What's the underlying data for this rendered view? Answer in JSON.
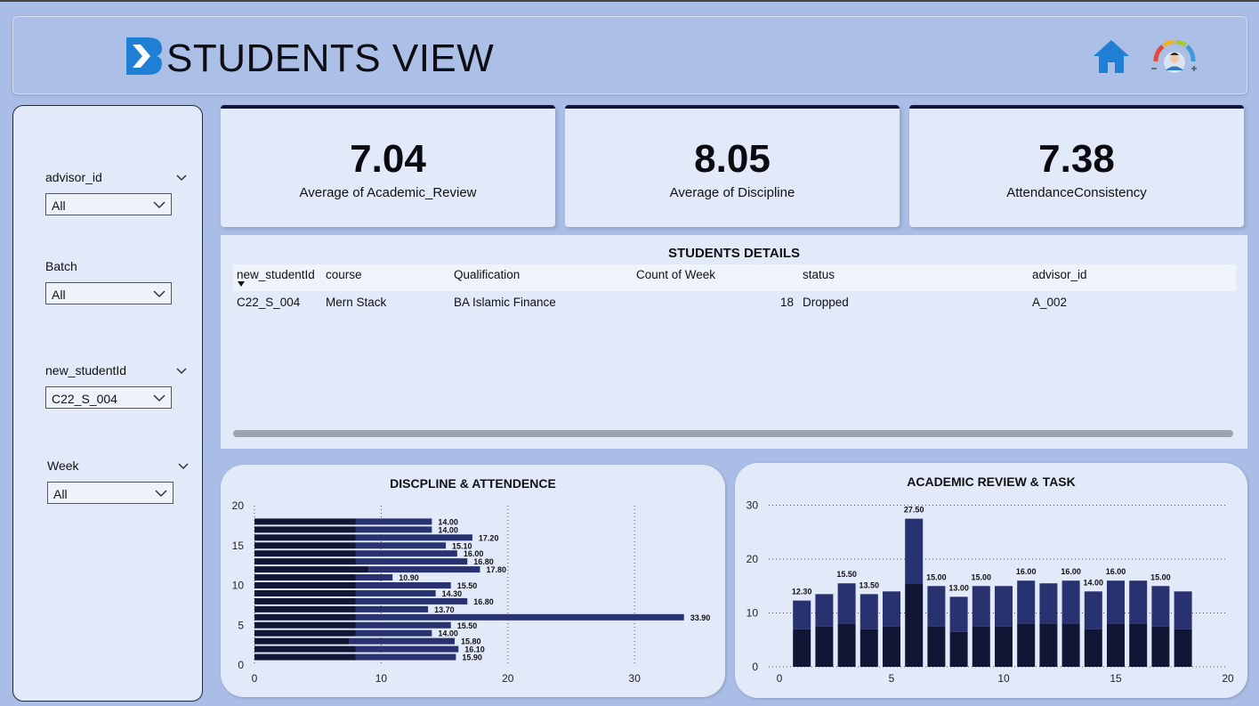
{
  "header": {
    "title": "STUDENTS VIEW"
  },
  "filters": [
    {
      "label": "advisor_id",
      "value": "All"
    },
    {
      "label": "Batch",
      "value": "All"
    },
    {
      "label": "new_studentId",
      "value": "C22_S_004"
    },
    {
      "label": "Week",
      "value": "All"
    }
  ],
  "cards": [
    {
      "value": "7.04",
      "label": "Average of Academic_Review"
    },
    {
      "value": "8.05",
      "label": "Average of Discipline"
    },
    {
      "value": "7.38",
      "label": "AttendanceConsistency"
    }
  ],
  "table": {
    "title": "STUDENTS DETAILS",
    "columns": [
      "new_studentId",
      "course",
      "Qualification",
      "Count of Week",
      "status",
      "advisor_id"
    ],
    "rows": [
      [
        "C22_S_004",
        "Mern Stack",
        "BA Islamic Finance",
        "18",
        "Dropped",
        "A_002"
      ]
    ]
  },
  "colors": {
    "dark": "#111634",
    "light": "#283270",
    "panel": "#e2e9f9"
  },
  "chart_data": [
    {
      "type": "bar",
      "orientation": "horizontal",
      "stacked": true,
      "title": "DISCPLINE & ATTENDENCE",
      "y": [
        18,
        17,
        16,
        15,
        14,
        13,
        12,
        11,
        10,
        9,
        8,
        7,
        6,
        5,
        4,
        3,
        2,
        1
      ],
      "series": [
        {
          "values": [
            8,
            8,
            8,
            8,
            8,
            8,
            9,
            8,
            8,
            8,
            8,
            8,
            8,
            8,
            8,
            7.5,
            8,
            8
          ]
        },
        {
          "values": [
            6,
            6,
            9.2,
            7.1,
            8,
            8.8,
            8.8,
            2.9,
            7.5,
            6.3,
            8.8,
            5.7,
            25.9,
            7.5,
            6,
            8.3,
            8.1,
            7.9
          ]
        }
      ],
      "totals": [
        "14.00",
        "14.00",
        "17.20",
        "15.10",
        "16.00",
        "16.80",
        "17.80",
        "10.90",
        "15.50",
        "14.30",
        "16.80",
        "13.70",
        "33.90",
        "15.50",
        "14.00",
        "15.80",
        "16.10",
        "15.90"
      ],
      "xlim": [
        0,
        35
      ],
      "ylim": [
        0,
        20
      ],
      "xticks": [
        "0",
        "10",
        "20",
        "30"
      ],
      "yticks": [
        "0",
        "5",
        "10",
        "15",
        "20"
      ],
      "grid": "vertical-dotted"
    },
    {
      "type": "bar",
      "stacked": true,
      "title": "ACADEMIC REVIEW & TASK",
      "x": [
        1,
        2,
        3,
        4,
        5,
        6,
        7,
        8,
        9,
        10,
        11,
        12,
        13,
        14,
        15,
        16,
        17,
        18
      ],
      "series": [
        {
          "values": [
            7,
            7.5,
            8,
            7,
            7.5,
            15.5,
            7.5,
            6.5,
            7.5,
            7.5,
            8,
            8,
            8,
            7,
            8,
            8,
            7.5,
            7
          ]
        },
        {
          "values": [
            5.3,
            6,
            7.5,
            6.5,
            6.5,
            12,
            7.5,
            6.5,
            7.5,
            7.5,
            8,
            7.5,
            8,
            7,
            8,
            8,
            7.5,
            7
          ]
        }
      ],
      "labels": [
        "12.30",
        "",
        "15.50",
        "13.50",
        "",
        "27.50",
        "15.00",
        "13.00",
        "15.00",
        "",
        "16.00",
        "",
        "16.00",
        "14.00",
        "16.00",
        "",
        "15.00",
        ""
      ],
      "xlim": [
        0,
        20
      ],
      "ylim": [
        0,
        30
      ],
      "xticks": [
        "0",
        "5",
        "10",
        "15",
        "20"
      ],
      "yticks": [
        "0",
        "10",
        "20",
        "30"
      ],
      "grid": "horizontal-dotted"
    }
  ]
}
